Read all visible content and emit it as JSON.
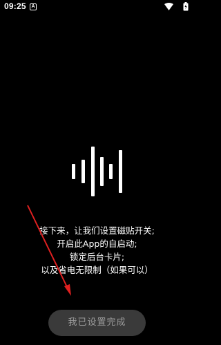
{
  "status_bar": {
    "time": "09:25",
    "notification_icon": "A"
  },
  "instructions": {
    "lines": [
      "接下来，让我们设置磁贴开关;",
      "开启此App的自启动;",
      "锁定后台卡片;",
      "以及省电无限制（如果可以）"
    ]
  },
  "button": {
    "label": "我已设置完成"
  },
  "colors": {
    "background": "#000000",
    "arrow": "#e02020",
    "button_bg": "#3a3a3a",
    "button_text": "#9b9b9b"
  },
  "icons": [
    "a-notification-icon",
    "wifi-icon",
    "battery-icon",
    "voice-wave-icon",
    "arrow-icon"
  ]
}
